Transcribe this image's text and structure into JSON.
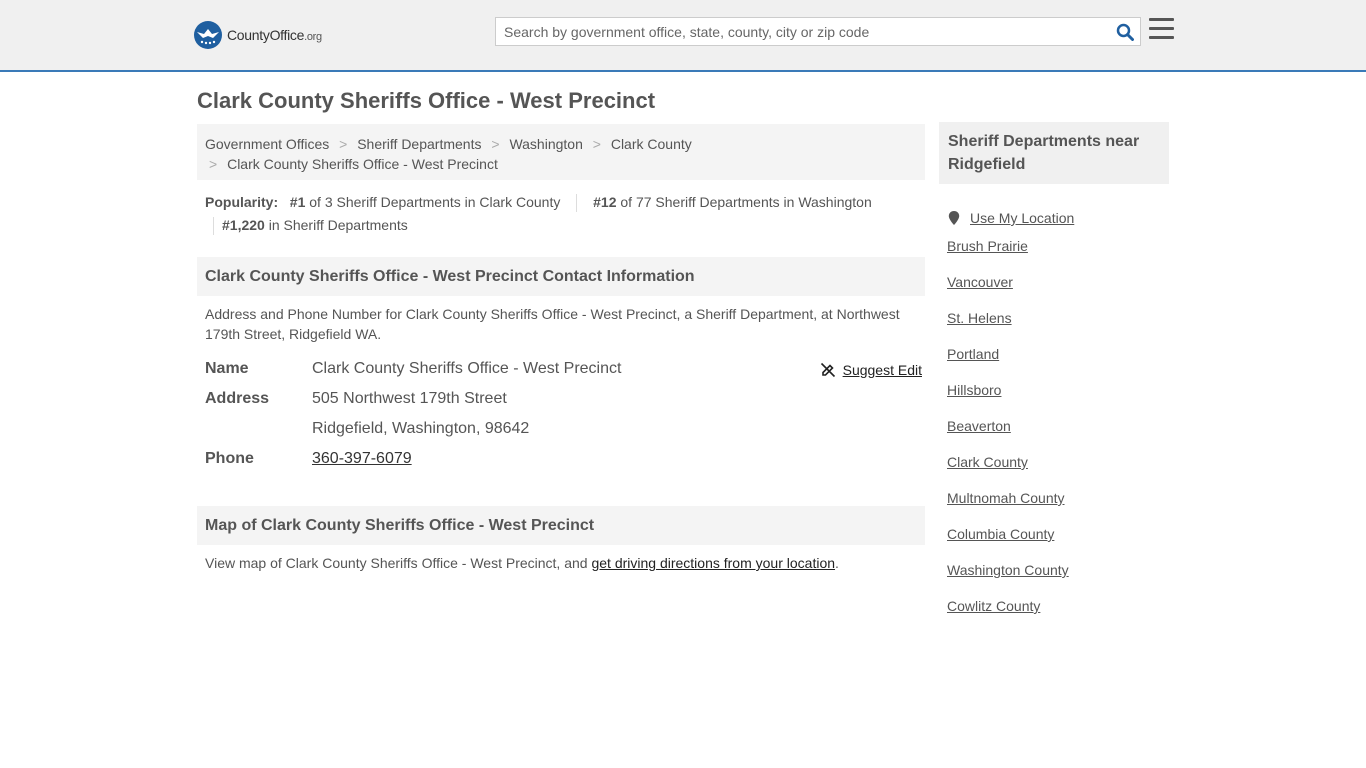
{
  "header": {
    "logo_main": "County",
    "logo_bold": "Office",
    "logo_tld": ".org",
    "search_placeholder": "Search by government office, state, county, city or zip code"
  },
  "page_title": "Clark County Sheriffs Office - West Precinct",
  "breadcrumb": [
    "Government Offices",
    "Sheriff Departments",
    "Washington",
    "Clark County",
    "Clark County Sheriffs Office - West Precinct"
  ],
  "breadcrumb_separator": ">",
  "popularity": {
    "label": "Popularity:",
    "rank1": "#1",
    "text1": "of 3 Sheriff Departments in Clark County",
    "rank2": "#12",
    "text2": "of 77 Sheriff Departments in Washington",
    "rank3": "#1,220",
    "text3": "in Sheriff Departments"
  },
  "contact": {
    "heading": "Clark County Sheriffs Office - West Precinct Contact Information",
    "description": "Address and Phone Number for Clark County Sheriffs Office - West Precinct, a Sheriff Department, at Northwest 179th Street, Ridgefield WA.",
    "name_label": "Name",
    "name_value": "Clark County Sheriffs Office - West Precinct",
    "suggest_edit": "Suggest Edit",
    "address_label": "Address",
    "address_line1": "505 Northwest 179th Street",
    "address_line2": "Ridgefield, Washington, 98642",
    "phone_label": "Phone",
    "phone_value": "360-397-6079"
  },
  "map": {
    "heading": "Map of Clark County Sheriffs Office - West Precinct",
    "desc_prefix": "View map of Clark County Sheriffs Office - West Precinct, and ",
    "desc_link": "get driving directions from your location",
    "desc_suffix": "."
  },
  "sidebar": {
    "heading": "Sheriff Departments near Ridgefield",
    "use_location": "Use My Location",
    "links": [
      "Brush Prairie",
      "Vancouver",
      "St. Helens",
      "Portland",
      "Hillsboro",
      "Beaverton",
      "Clark County",
      "Multnomah County",
      "Columbia County",
      "Washington County",
      "Cowlitz County"
    ]
  },
  "colors": {
    "accent_blue": "#1f5fa0",
    "header_bg": "#f0f0f0",
    "header_border": "#3a7ab8"
  }
}
